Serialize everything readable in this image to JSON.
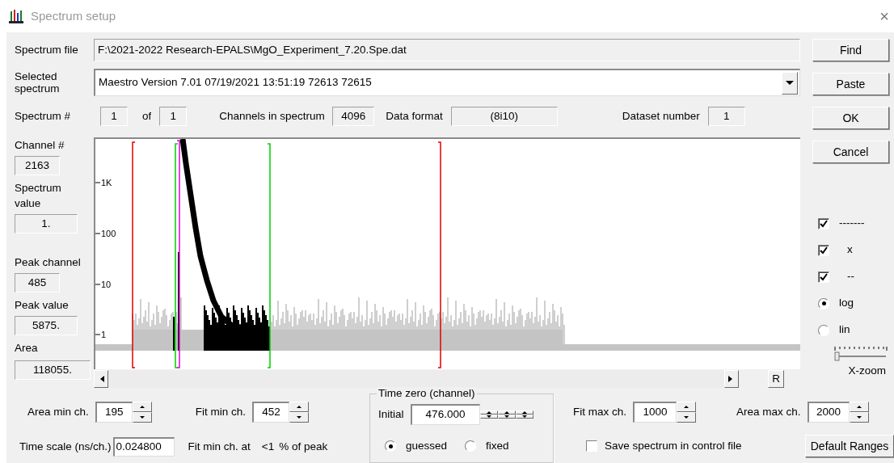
{
  "window": {
    "title": "Spectrum setup",
    "close_glyph": "×"
  },
  "spectrum_file": {
    "label": "Spectrum file",
    "value": "F:\\2021-2022 Research-EPALS\\MgO_Experiment_7.20.Spe.dat"
  },
  "selected_spectrum": {
    "label": "Selected spectrum",
    "value": "Maestro Version 7.01 07/19/2021 13:51:19 72613 72615"
  },
  "info_row": [
    {
      "label": "Spectrum #",
      "value": "1"
    },
    {
      "label": "of",
      "value": "1"
    },
    {
      "label": "Channels in spectrum",
      "value": "4096"
    },
    {
      "label": "Data format",
      "value": "(8i10)"
    },
    {
      "label": "Dataset number",
      "value": "1"
    }
  ],
  "readouts": [
    {
      "label": "Channel #",
      "value": "2163"
    },
    {
      "label": "Spectrum value",
      "value": "1."
    },
    {
      "label": "Peak channel",
      "value": "485"
    },
    {
      "label": "Peak value",
      "value": "5875."
    },
    {
      "label": "Area",
      "value": "118055."
    }
  ],
  "plot": {
    "y_ticks": [
      "1K",
      "100",
      "10",
      "1"
    ]
  },
  "scroll_reset_button": "R",
  "buttons": [
    "Find",
    "Paste",
    "OK",
    "Cancel"
  ],
  "display_options": [
    {
      "kind": "checkbox",
      "label": "-------",
      "checked": true
    },
    {
      "kind": "checkbox",
      "label": "x",
      "checked": true
    },
    {
      "kind": "checkbox",
      "label": "--",
      "checked": true
    },
    {
      "kind": "radio",
      "label": "log",
      "selected": true
    },
    {
      "kind": "radio",
      "label": "lin",
      "selected": false
    }
  ],
  "x_zoom": {
    "label": "X-zoom",
    "level": 0
  },
  "left_spinners": [
    {
      "label": "Area min ch.",
      "value": "195"
    },
    {
      "label": "Fit min ch.",
      "value": "452"
    }
  ],
  "time_scale": {
    "label": "Time scale (ns/ch.)",
    "value": "0.024800"
  },
  "fit_min_threshold": {
    "label": "Fit min ch. at",
    "value": "<1",
    "suffix": "% of peak"
  },
  "time_zero": {
    "title": "Time zero (channel)",
    "initial_label": "Initial",
    "initial_value": "476.000",
    "modes": [
      {
        "label": "guessed",
        "selected": true
      },
      {
        "label": "fixed",
        "selected": false
      }
    ]
  },
  "right_spinners": [
    {
      "label": "Fit max ch.",
      "value": "1000"
    },
    {
      "label": "Area max ch.",
      "value": "2000"
    }
  ],
  "save_spectrum": {
    "label": "Save spectrum in control file",
    "checked": false
  },
  "default_ranges_button": "Default Ranges"
}
